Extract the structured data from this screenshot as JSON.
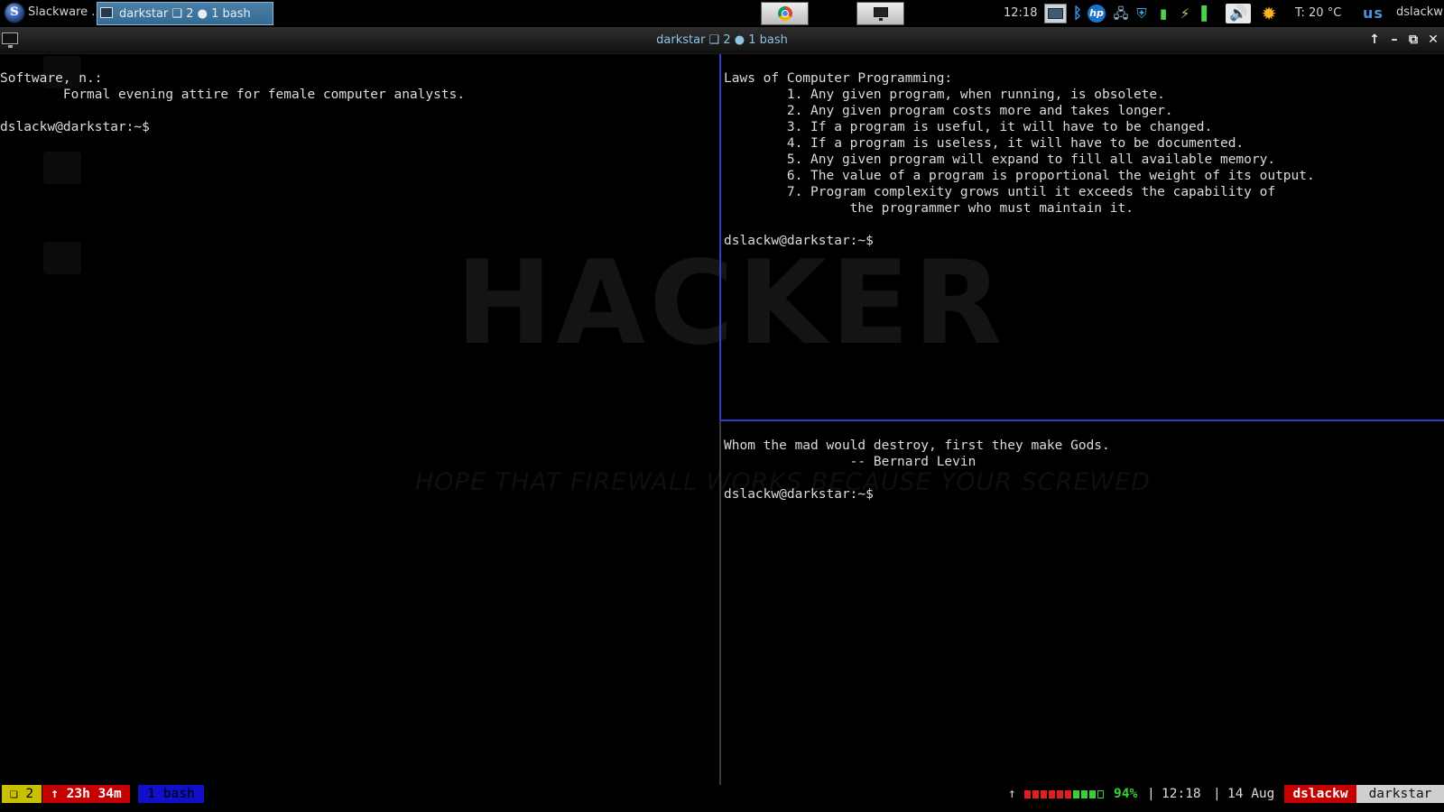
{
  "taskbar": {
    "start_label": "Slackware ...",
    "start_glyph": "S",
    "task_label": "darkstar ❑ 2 ● 1 bash",
    "clock": "12:18",
    "temperature": "T: 20 °C",
    "keyboard_layout": "us",
    "user": "dslackw",
    "hp_label": "hp",
    "tray_icons": [
      "monitor-icon",
      "bluetooth-icon",
      "hp-icon",
      "network-icon",
      "shield-icon",
      "battery-icon",
      "power-plug-icon",
      "signal-icon",
      "volume-icon",
      "weather-sun-icon"
    ]
  },
  "window": {
    "title": "darkstar ❑ 2 ● 1 bash",
    "controls": [
      "arrow-up",
      "minimize",
      "maximize",
      "close"
    ]
  },
  "wallpaper": {
    "word": "HACKER",
    "slogan": "HOPE THAT FIREWALL WORKS BECAUSE YOUR SCREWED"
  },
  "panes": {
    "left": {
      "lines": [
        "",
        "Software, n.:",
        "        Formal evening attire for female computer analysts.",
        "",
        "dslackw@darkstar:~$"
      ]
    },
    "top_right": {
      "lines": [
        "",
        "Laws of Computer Programming:",
        "        1. Any given program, when running, is obsolete.",
        "        2. Any given program costs more and takes longer.",
        "        3. If a program is useful, it will have to be changed.",
        "        4. If a program is useless, it will have to be documented.",
        "        5. Any given program will expand to fill all available memory.",
        "        6. The value of a program is proportional the weight of its output.",
        "        7. Program complexity grows until it exceeds the capability of",
        "                the programmer who must maintain it.",
        "",
        "dslackw@darkstar:~$"
      ]
    },
    "bottom_right": {
      "lines": [
        "",
        "Whom the mad would destroy, first they make Gods.",
        "                -- Bernard Levin",
        "",
        "dslackw@darkstar:~$"
      ]
    }
  },
  "status_bar": {
    "session": "❑ 2",
    "uptime": "↑ 23h 34m",
    "window": "1 bash",
    "arrow": "↑",
    "battery_percent": 94,
    "battery_label": "94%",
    "separator": "|",
    "time": "12:18",
    "date": "14 Aug",
    "user": "dslackw",
    "host": "darkstar",
    "colors": {
      "session_bg": "#c8c000",
      "uptime_bg": "#c40000",
      "window_bg": "#1010c8",
      "battery_good": "#38d038",
      "battery_low": "#e02020",
      "user_bg": "#c40000",
      "host_bg": "#cfcfcf"
    }
  }
}
